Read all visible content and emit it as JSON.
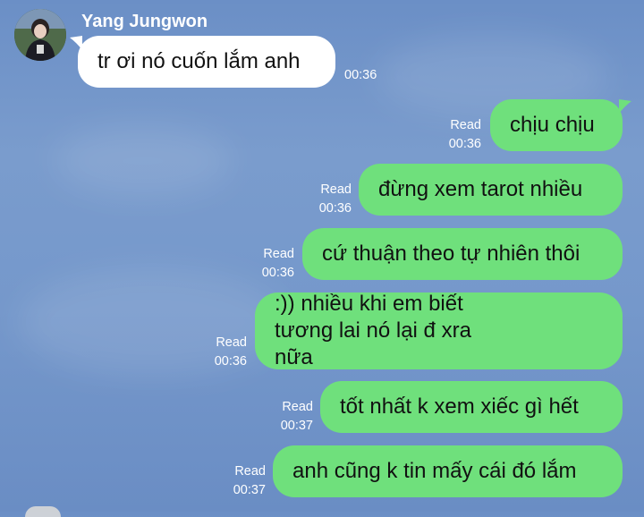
{
  "chat": {
    "sender_name": "Yang Jungwon",
    "incoming": [
      {
        "text": "tr ơi nó cuốn lắm anh",
        "time": "00:36"
      }
    ],
    "outgoing": [
      {
        "text": "chịu chịu",
        "status": "Read",
        "time": "00:36"
      },
      {
        "text": "đừng xem tarot nhiều",
        "status": "Read",
        "time": "00:36"
      },
      {
        "text": "cứ thuận theo tự nhiên thôi",
        "status": "Read",
        "time": "00:36"
      },
      {
        "text": ":)) nhiều khi em biết tương lai nó lại đ xra nữa",
        "status": "Read",
        "time": "00:36"
      },
      {
        "text": "tốt nhất k xem xiếc gì hết",
        "status": "Read",
        "time": "00:37"
      },
      {
        "text": "anh cũng k tin mấy cái đó lắm",
        "status": "Read",
        "time": "00:37"
      }
    ]
  },
  "colors": {
    "background": "#7598cb",
    "incoming_bubble": "#ffffff",
    "outgoing_bubble": "#6fe07c"
  }
}
